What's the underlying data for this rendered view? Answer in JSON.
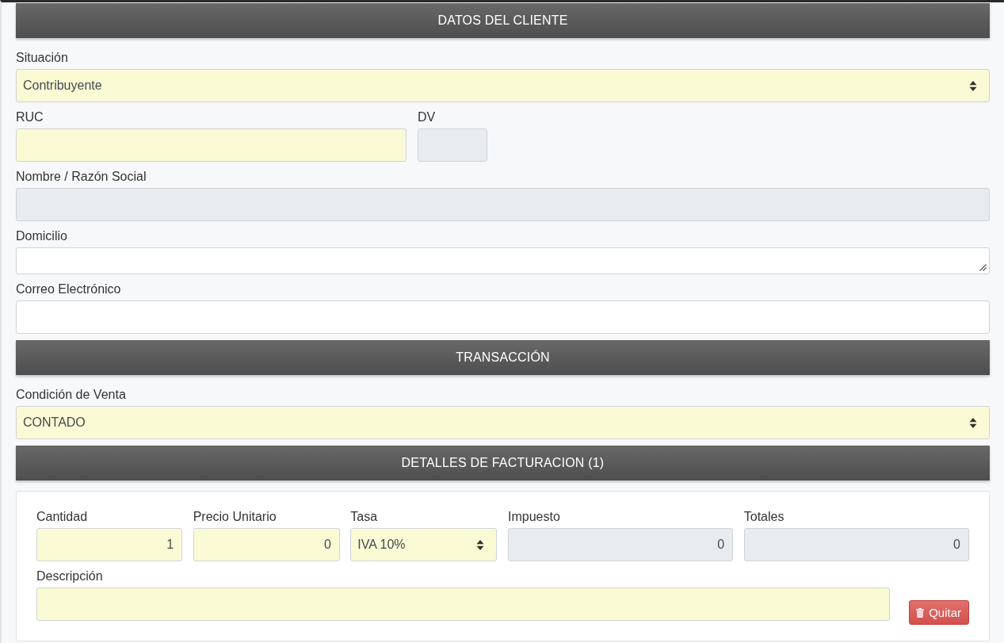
{
  "sections": [
    {
      "title": "DATOS DEL CLIENTE",
      "kind": "form",
      "rows": [
        [
          {
            "label": "Situación",
            "kind": "select",
            "value": "Contribuyente",
            "required": true,
            "disabled": false
          }
        ],
        [
          {
            "label": "RUC",
            "kind": "text",
            "required": true,
            "disabled": false
          },
          {
            "label": "DV",
            "kind": "text",
            "required": false,
            "disabled": true
          }
        ],
        [
          {
            "label": "Nombre / Razón Social",
            "kind": "text",
            "required": false,
            "disabled": true
          }
        ],
        [
          {
            "label": "Domicilio",
            "kind": "textarea",
            "required": false,
            "disabled": false
          }
        ],
        [
          {
            "label": "Correo Electrónico",
            "kind": "text",
            "required": false,
            "disabled": false
          }
        ]
      ]
    },
    {
      "title": "TRANSACCIÓN",
      "kind": "form",
      "rows": [
        [
          {
            "label": "Condición de Venta",
            "kind": "select",
            "value": "CONTADO",
            "required": true,
            "disabled": false
          }
        ]
      ]
    },
    {
      "title": "DETALLES DE FACTURACION (1)",
      "kind": "items",
      "items": [
        {
          "rows": [
            [
              {
                "label": "Cantidad",
                "kind": "number",
                "value": "1",
                "required": true,
                "disabled": false
              },
              {
                "label": "Precio Unitario",
                "kind": "number",
                "value": "0",
                "required": true,
                "disabled": false
              },
              {
                "label": "Tasa",
                "kind": "select",
                "value": "IVA 10%",
                "required": true,
                "disabled": false
              },
              {
                "label": "Impuesto",
                "kind": "number",
                "value": "0",
                "required": false,
                "disabled": true
              },
              {
                "label": "Totales",
                "kind": "number",
                "value": "0",
                "required": false,
                "disabled": true
              }
            ],
            [
              {
                "label": "Descripción",
                "kind": "text",
                "required": true,
                "disabled": false
              }
            ]
          ],
          "remove_button": "Quitar"
        }
      ]
    }
  ]
}
